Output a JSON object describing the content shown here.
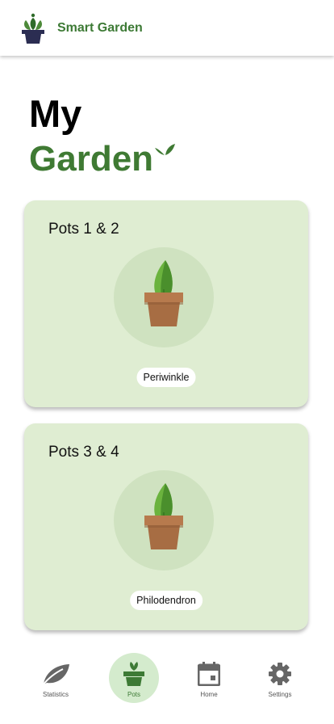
{
  "header": {
    "brand": "Smart Garden",
    "logo_icon": "plant-pot-logo-icon"
  },
  "title": {
    "line1": "My",
    "line2": "Garden"
  },
  "cards": [
    {
      "title": "Pots 1 & 2",
      "plant": "Periwinkle",
      "icon": "potted-plant-icon"
    },
    {
      "title": "Pots 3 & 4",
      "plant": "Philodendron",
      "icon": "potted-plant-icon"
    }
  ],
  "nav": {
    "items": [
      {
        "label": "Statistics",
        "icon": "leaf-icon"
      },
      {
        "label": "Pots",
        "icon": "pot-icon",
        "active": true
      },
      {
        "label": "Home",
        "icon": "calendar-icon"
      },
      {
        "label": "Settings",
        "icon": "gear-icon"
      }
    ]
  },
  "colors": {
    "brand_green": "#3d7a35",
    "card_bg": "#dfedd2",
    "circle_bg": "#cfe2c0",
    "active_nav_bg": "#d4ebcd"
  }
}
